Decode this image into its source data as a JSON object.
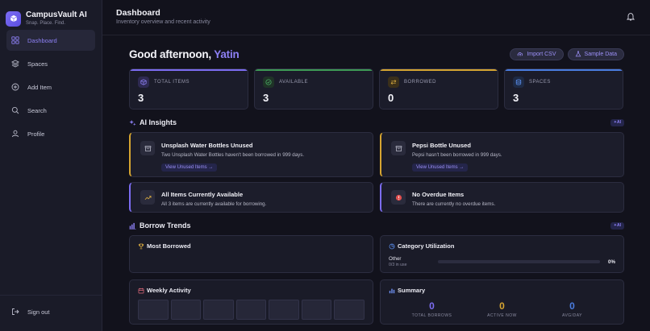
{
  "brand": {
    "title": "CampusVault AI",
    "subtitle": "Snap. Place. Find."
  },
  "nav": [
    {
      "label": "Dashboard",
      "icon": "grid-icon",
      "active": true
    },
    {
      "label": "Spaces",
      "icon": "layers-icon"
    },
    {
      "label": "Add Item",
      "icon": "plus-circle-icon"
    },
    {
      "label": "Search",
      "icon": "search-icon"
    },
    {
      "label": "Profile",
      "icon": "user-icon"
    }
  ],
  "signout": {
    "label": "Sign out"
  },
  "header": {
    "title": "Dashboard",
    "subtitle": "Inventory overview and recent activity"
  },
  "greeting": {
    "prefix": "Good afternoon, ",
    "name": "Yatin"
  },
  "actions": {
    "import_label": "Import CSV",
    "sample_label": "Sample Data"
  },
  "stats": [
    {
      "label": "TOTAL ITEMS",
      "value": "3",
      "color": "#7c6df2"
    },
    {
      "label": "AVAILABLE",
      "value": "3",
      "color": "#3e9a55"
    },
    {
      "label": "BORROWED",
      "value": "0",
      "color": "#d6a531"
    },
    {
      "label": "SPACES",
      "value": "3",
      "color": "#4a7de0"
    }
  ],
  "ai_insights": {
    "title": "AI Insights",
    "badge": "AI",
    "cards": [
      {
        "title": "Unsplash Water Bottles Unused",
        "desc": "Two Unsplash Water Bottles haven't been borrowed in 999 days.",
        "link": "View Unused Items →"
      },
      {
        "title": "Pepsi Bottle Unused",
        "desc": "Pepsi hasn't been borrowed in 999 days.",
        "link": "View Unused Items →"
      },
      {
        "title": "All Items Currently Available",
        "desc": "All 3 items are currently available for borrowing."
      },
      {
        "title": "No Overdue Items",
        "desc": "There are currently no overdue items."
      }
    ]
  },
  "borrow_trends": {
    "title": "Borrow Trends",
    "badge": "AI",
    "most_borrowed": {
      "title": "Most Borrowed"
    },
    "category": {
      "title": "Category Utilization",
      "rows": [
        {
          "name": "Other",
          "sub": "0/3 in use",
          "percent": "0%",
          "fraction": 0
        }
      ]
    },
    "weekly": {
      "title": "Weekly Activity",
      "days": 7
    },
    "summary": {
      "title": "Summary",
      "items": [
        {
          "value": "0",
          "label": "TOTAL BORROWS",
          "color": "#7c6df2"
        },
        {
          "value": "0",
          "label": "ACTIVE NOW",
          "color": "#d6a531"
        },
        {
          "value": "0",
          "label": "AVG/DAY",
          "color": "#4a7de0"
        }
      ]
    }
  }
}
